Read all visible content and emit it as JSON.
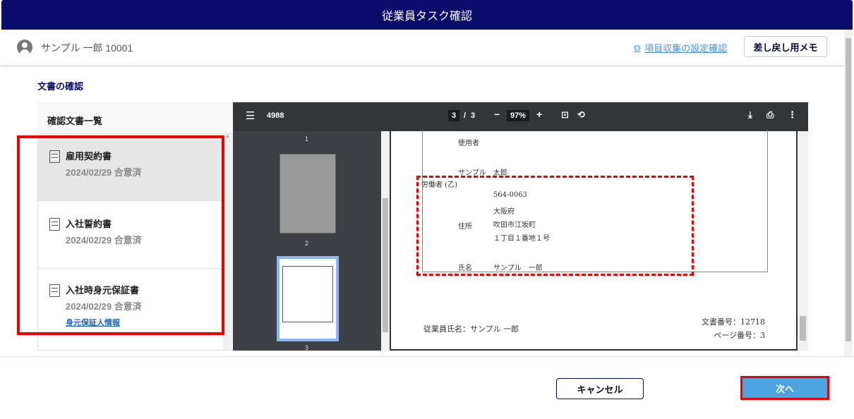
{
  "header": {
    "title": "従業員タスク確認"
  },
  "subheader": {
    "user": "サンプル 一郎 10001",
    "settings_link": "項目収集の設定確認",
    "memo_button": "差し戻し用メモ"
  },
  "section_title": "文書の確認",
  "doc_list": {
    "title": "確認文書一覧",
    "items": [
      {
        "title": "雇用契約書",
        "date": "2024/02/29 合意済"
      },
      {
        "title": "入社誓約書",
        "date": "2024/02/29 合意済"
      },
      {
        "title": "入社時身元保証書",
        "date": "2024/02/29 合意済",
        "link": "身元保証人情報"
      }
    ]
  },
  "viewer": {
    "doc_name": "4988",
    "current_page": "3",
    "page_sep": "/",
    "total_pages": "3",
    "zoom": "97%",
    "thumb_labels": [
      "1",
      "2",
      "3"
    ],
    "page": {
      "employer_label": "使用者",
      "employer_name": "サンプル　太郎",
      "worker_label": "労働者 (乙)",
      "postal": "564-0063",
      "pref": "大阪府",
      "city": "吹田市江坂町",
      "street": "１丁目１番地１号",
      "address_label": "住所",
      "name_label": "氏名",
      "worker_name": "サンプル　一郎",
      "footer_employee": "従業員氏名：サンプル 一郎",
      "doc_number": "文書番号：12718",
      "page_number": "ページ番号：3"
    }
  },
  "footer": {
    "cancel": "キャンセル",
    "next": "次へ"
  }
}
